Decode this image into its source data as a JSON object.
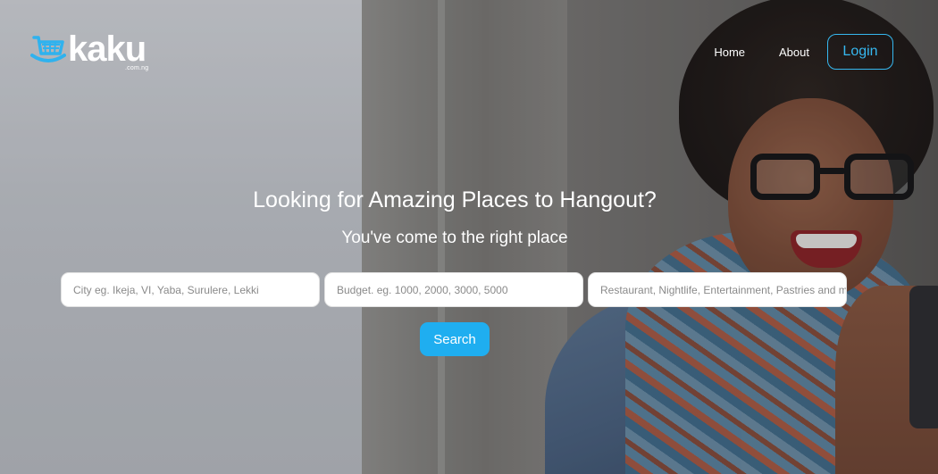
{
  "brand": {
    "name": "kaku",
    "domain_suffix": ".com.ng",
    "accent_color": "#1faef0",
    "icon": "shopping-basket-icon"
  },
  "nav": {
    "items": [
      {
        "label": "Home"
      },
      {
        "label": "About"
      }
    ],
    "login_label": "Login"
  },
  "hero": {
    "headline": "Looking for Amazing Places to Hangout?",
    "subheadline": "You've come to the right place"
  },
  "search": {
    "city_placeholder": "City eg. Ikeja, VI, Yaba, Surulere, Lekki",
    "budget_placeholder": "Budget. eg. 1000, 2000, 3000, 5000",
    "category_placeholder": "Restaurant, Nightlife, Entertainment, Pastries and more",
    "button_label": "Search"
  }
}
